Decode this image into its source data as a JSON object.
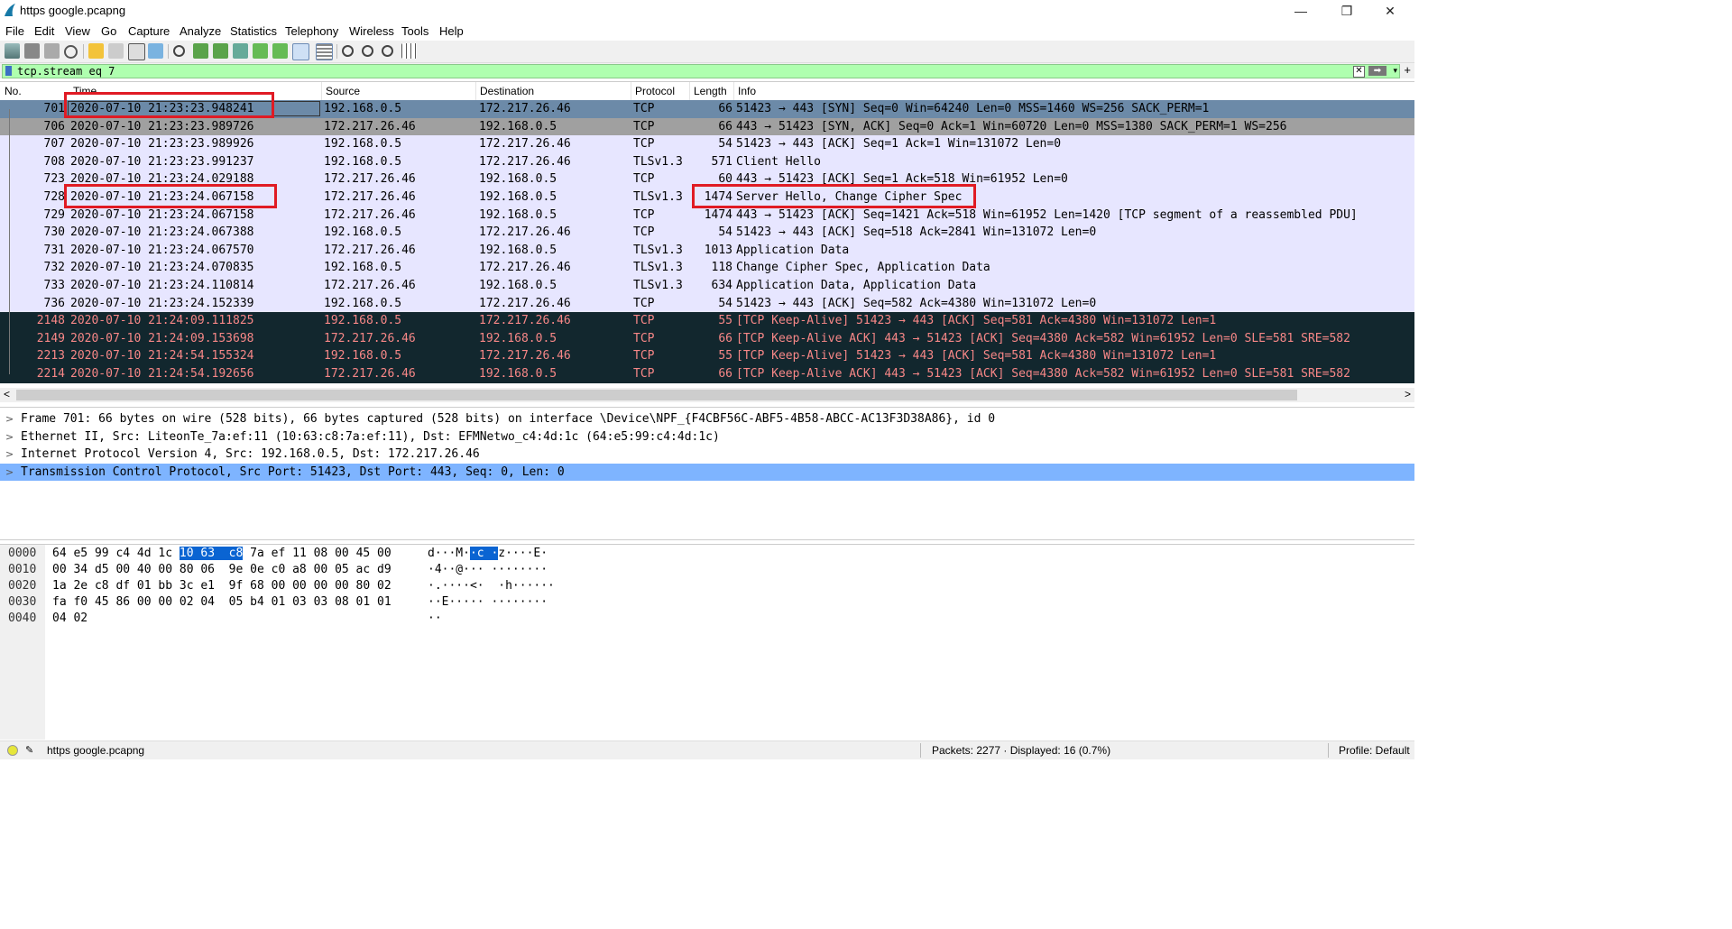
{
  "window": {
    "title": "https google.pcapng",
    "minimize": "—",
    "maximize": "❐",
    "close": "✕"
  },
  "menu": [
    "File",
    "Edit",
    "View",
    "Go",
    "Capture",
    "Analyze",
    "Statistics",
    "Telephony",
    "Wireless",
    "Tools",
    "Help"
  ],
  "filter": {
    "text": "tcp.stream eq 7",
    "clear": "✕",
    "apply": "➡",
    "dropdown": "▾",
    "add": "+"
  },
  "columns": {
    "no": "No.",
    "time": "Time",
    "source": "Source",
    "destination": "Destination",
    "protocol": "Protocol",
    "length": "Length",
    "info": "Info"
  },
  "packets": [
    {
      "no": "701",
      "time": "2020-07-10 21:23:23.948241",
      "src": "192.168.0.5",
      "dst": "172.217.26.46",
      "proto": "TCP",
      "len": "66",
      "info": "51423 → 443 [SYN] Seq=0 Win=64240 Len=0 MSS=1460 WS=256 SACK_PERM=1",
      "style": "selected"
    },
    {
      "no": "706",
      "time": "2020-07-10 21:23:23.989726",
      "src": "172.217.26.46",
      "dst": "192.168.0.5",
      "proto": "TCP",
      "len": "66",
      "info": "443 → 51423 [SYN, ACK] Seq=0 Ack=1 Win=60720 Len=0 MSS=1380 SACK_PERM=1 WS=256",
      "style": "synack"
    },
    {
      "no": "707",
      "time": "2020-07-10 21:23:23.989926",
      "src": "192.168.0.5",
      "dst": "172.217.26.46",
      "proto": "TCP",
      "len": "54",
      "info": "51423 → 443 [ACK] Seq=1 Ack=1 Win=131072 Len=0",
      "style": "normal"
    },
    {
      "no": "708",
      "time": "2020-07-10 21:23:23.991237",
      "src": "192.168.0.5",
      "dst": "172.217.26.46",
      "proto": "TLSv1.3",
      "len": "571",
      "info": "Client Hello",
      "style": "normal"
    },
    {
      "no": "723",
      "time": "2020-07-10 21:23:24.029188",
      "src": "172.217.26.46",
      "dst": "192.168.0.5",
      "proto": "TCP",
      "len": "60",
      "info": "443 → 51423 [ACK] Seq=1 Ack=518 Win=61952 Len=0",
      "style": "normal"
    },
    {
      "no": "728",
      "time": "2020-07-10 21:23:24.067158",
      "src": "172.217.26.46",
      "dst": "192.168.0.5",
      "proto": "TLSv1.3",
      "len": "1474",
      "info": "Server Hello, Change Cipher Spec",
      "style": "normal"
    },
    {
      "no": "729",
      "time": "2020-07-10 21:23:24.067158",
      "src": "172.217.26.46",
      "dst": "192.168.0.5",
      "proto": "TCP",
      "len": "1474",
      "info": "443 → 51423 [ACK] Seq=1421 Ack=518 Win=61952 Len=1420 [TCP segment of a reassembled PDU]",
      "style": "normal"
    },
    {
      "no": "730",
      "time": "2020-07-10 21:23:24.067388",
      "src": "192.168.0.5",
      "dst": "172.217.26.46",
      "proto": "TCP",
      "len": "54",
      "info": "51423 → 443 [ACK] Seq=518 Ack=2841 Win=131072 Len=0",
      "style": "normal"
    },
    {
      "no": "731",
      "time": "2020-07-10 21:23:24.067570",
      "src": "172.217.26.46",
      "dst": "192.168.0.5",
      "proto": "TLSv1.3",
      "len": "1013",
      "info": "Application Data",
      "style": "normal"
    },
    {
      "no": "732",
      "time": "2020-07-10 21:23:24.070835",
      "src": "192.168.0.5",
      "dst": "172.217.26.46",
      "proto": "TLSv1.3",
      "len": "118",
      "info": "Change Cipher Spec, Application Data",
      "style": "normal"
    },
    {
      "no": "733",
      "time": "2020-07-10 21:23:24.110814",
      "src": "172.217.26.46",
      "dst": "192.168.0.5",
      "proto": "TLSv1.3",
      "len": "634",
      "info": "Application Data, Application Data",
      "style": "normal"
    },
    {
      "no": "736",
      "time": "2020-07-10 21:23:24.152339",
      "src": "192.168.0.5",
      "dst": "172.217.26.46",
      "proto": "TCP",
      "len": "54",
      "info": "51423 → 443 [ACK] Seq=582 Ack=4380 Win=131072 Len=0",
      "style": "normal"
    },
    {
      "no": "2148",
      "time": "2020-07-10 21:24:09.111825",
      "src": "192.168.0.5",
      "dst": "172.217.26.46",
      "proto": "TCP",
      "len": "55",
      "info": "[TCP Keep-Alive] 51423 → 443 [ACK] Seq=581 Ack=4380 Win=131072 Len=1",
      "style": "dark"
    },
    {
      "no": "2149",
      "time": "2020-07-10 21:24:09.153698",
      "src": "172.217.26.46",
      "dst": "192.168.0.5",
      "proto": "TCP",
      "len": "66",
      "info": "[TCP Keep-Alive ACK] 443 → 51423 [ACK] Seq=4380 Ack=582 Win=61952 Len=0 SLE=581 SRE=582",
      "style": "dark"
    },
    {
      "no": "2213",
      "time": "2020-07-10 21:24:54.155324",
      "src": "192.168.0.5",
      "dst": "172.217.26.46",
      "proto": "TCP",
      "len": "55",
      "info": "[TCP Keep-Alive] 51423 → 443 [ACK] Seq=581 Ack=4380 Win=131072 Len=1",
      "style": "dark"
    },
    {
      "no": "2214",
      "time": "2020-07-10 21:24:54.192656",
      "src": "172.217.26.46",
      "dst": "192.168.0.5",
      "proto": "TCP",
      "len": "66",
      "info": "[TCP Keep-Alive ACK] 443 → 51423 [ACK] Seq=4380 Ack=582 Win=61952 Len=0 SLE=581 SRE=582",
      "style": "dark"
    }
  ],
  "details": [
    "Frame 701: 66 bytes on wire (528 bits), 66 bytes captured (528 bits) on interface \\Device\\NPF_{F4CBF56C-ABF5-4B58-ABCC-AC13F3D38A86}, id 0",
    "Ethernet II, Src: LiteonTe_7a:ef:11 (10:63:c8:7a:ef:11), Dst: EFMNetwo_c4:4d:1c (64:e5:99:c4:4d:1c)",
    "Internet Protocol Version 4, Src: 192.168.0.5, Dst: 172.217.26.46",
    "Transmission Control Protocol, Src Port: 51423, Dst Port: 443, Seq: 0, Len: 0"
  ],
  "bytes": [
    {
      "off": "0000",
      "hex_pre": "64 e5 99 c4 4d 1c ",
      "hex_hl": "10 63  c8",
      "hex_post": " 7a ef 11 08 00 45 00",
      "asc_pre": "d···M·",
      "asc_hl": "·c ·",
      "asc_post": "z····E·"
    },
    {
      "off": "0010",
      "hex_pre": "00 34 d5 00 40 00 80 06  9e 0e c0 a8 00 05 ac d9",
      "hex_hl": "",
      "hex_post": "",
      "asc_pre": "·4··@··· ········",
      "asc_hl": "",
      "asc_post": ""
    },
    {
      "off": "0020",
      "hex_pre": "1a 2e c8 df 01 bb 3c e1  9f 68 00 00 00 00 80 02",
      "hex_hl": "",
      "hex_post": "",
      "asc_pre": "·.····<·  ·h······",
      "asc_hl": "",
      "asc_post": ""
    },
    {
      "off": "0030",
      "hex_pre": "fa f0 45 86 00 00 02 04  05 b4 01 03 03 08 01 01",
      "hex_hl": "",
      "hex_post": "",
      "asc_pre": "··E····· ········",
      "asc_hl": "",
      "asc_post": ""
    },
    {
      "off": "0040",
      "hex_pre": "04 02",
      "hex_hl": "",
      "hex_post": "",
      "asc_pre": "··",
      "asc_hl": "",
      "asc_post": ""
    }
  ],
  "status": {
    "file": "https google.pcapng",
    "counts": "Packets: 2277 · Displayed: 16 (0.7%)",
    "profile": "Profile: Default"
  },
  "colors": {
    "selected": "#6c8aa8",
    "synack": "#a0a0a0",
    "normal": "#e7e6ff",
    "dark": "#12272e",
    "dark_text": "#f78787",
    "highlight": "#7eb4ff"
  }
}
